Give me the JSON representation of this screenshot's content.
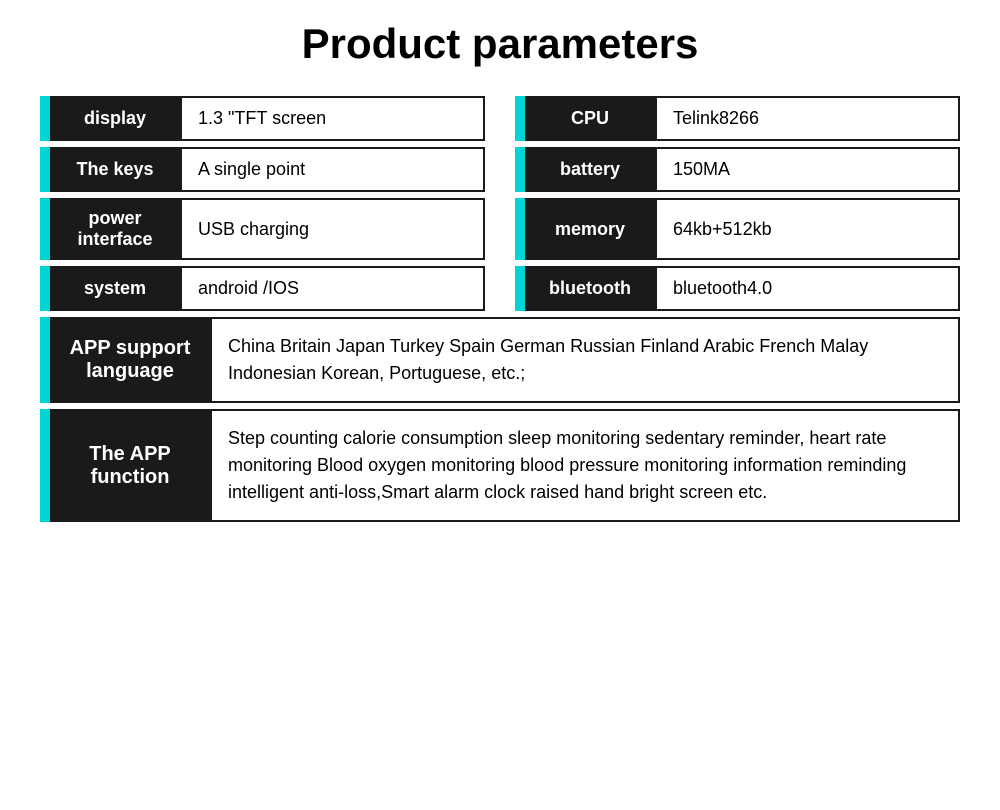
{
  "title": "Product parameters",
  "rows": [
    {
      "left": {
        "label": "display",
        "value": "1.3 \"TFT screen"
      },
      "right": {
        "label": "CPU",
        "value": "Telink8266"
      }
    },
    {
      "left": {
        "label": "The keys",
        "value": "A single point"
      },
      "right": {
        "label": "battery",
        "value": "150MA"
      }
    },
    {
      "left": {
        "label": "power interface",
        "value": "USB charging"
      },
      "right": {
        "label": "memory",
        "value": "64kb+512kb"
      }
    },
    {
      "left": {
        "label": "system",
        "value": "android /IOS"
      },
      "right": {
        "label": "bluetooth",
        "value": "bluetooth4.0"
      }
    }
  ],
  "app_language": {
    "label": "APP support language",
    "value": "China Britain Japan Turkey Spain German Russian Finland Arabic French Malay Indonesian Korean, Portuguese, etc.;"
  },
  "app_function": {
    "label": "The APP function",
    "value": "Step counting calorie consumption sleep monitoring sedentary reminder, heart rate monitoring Blood oxygen monitoring blood pressure monitoring information reminding intelligent anti-loss,Smart alarm clock raised hand bright screen etc."
  }
}
